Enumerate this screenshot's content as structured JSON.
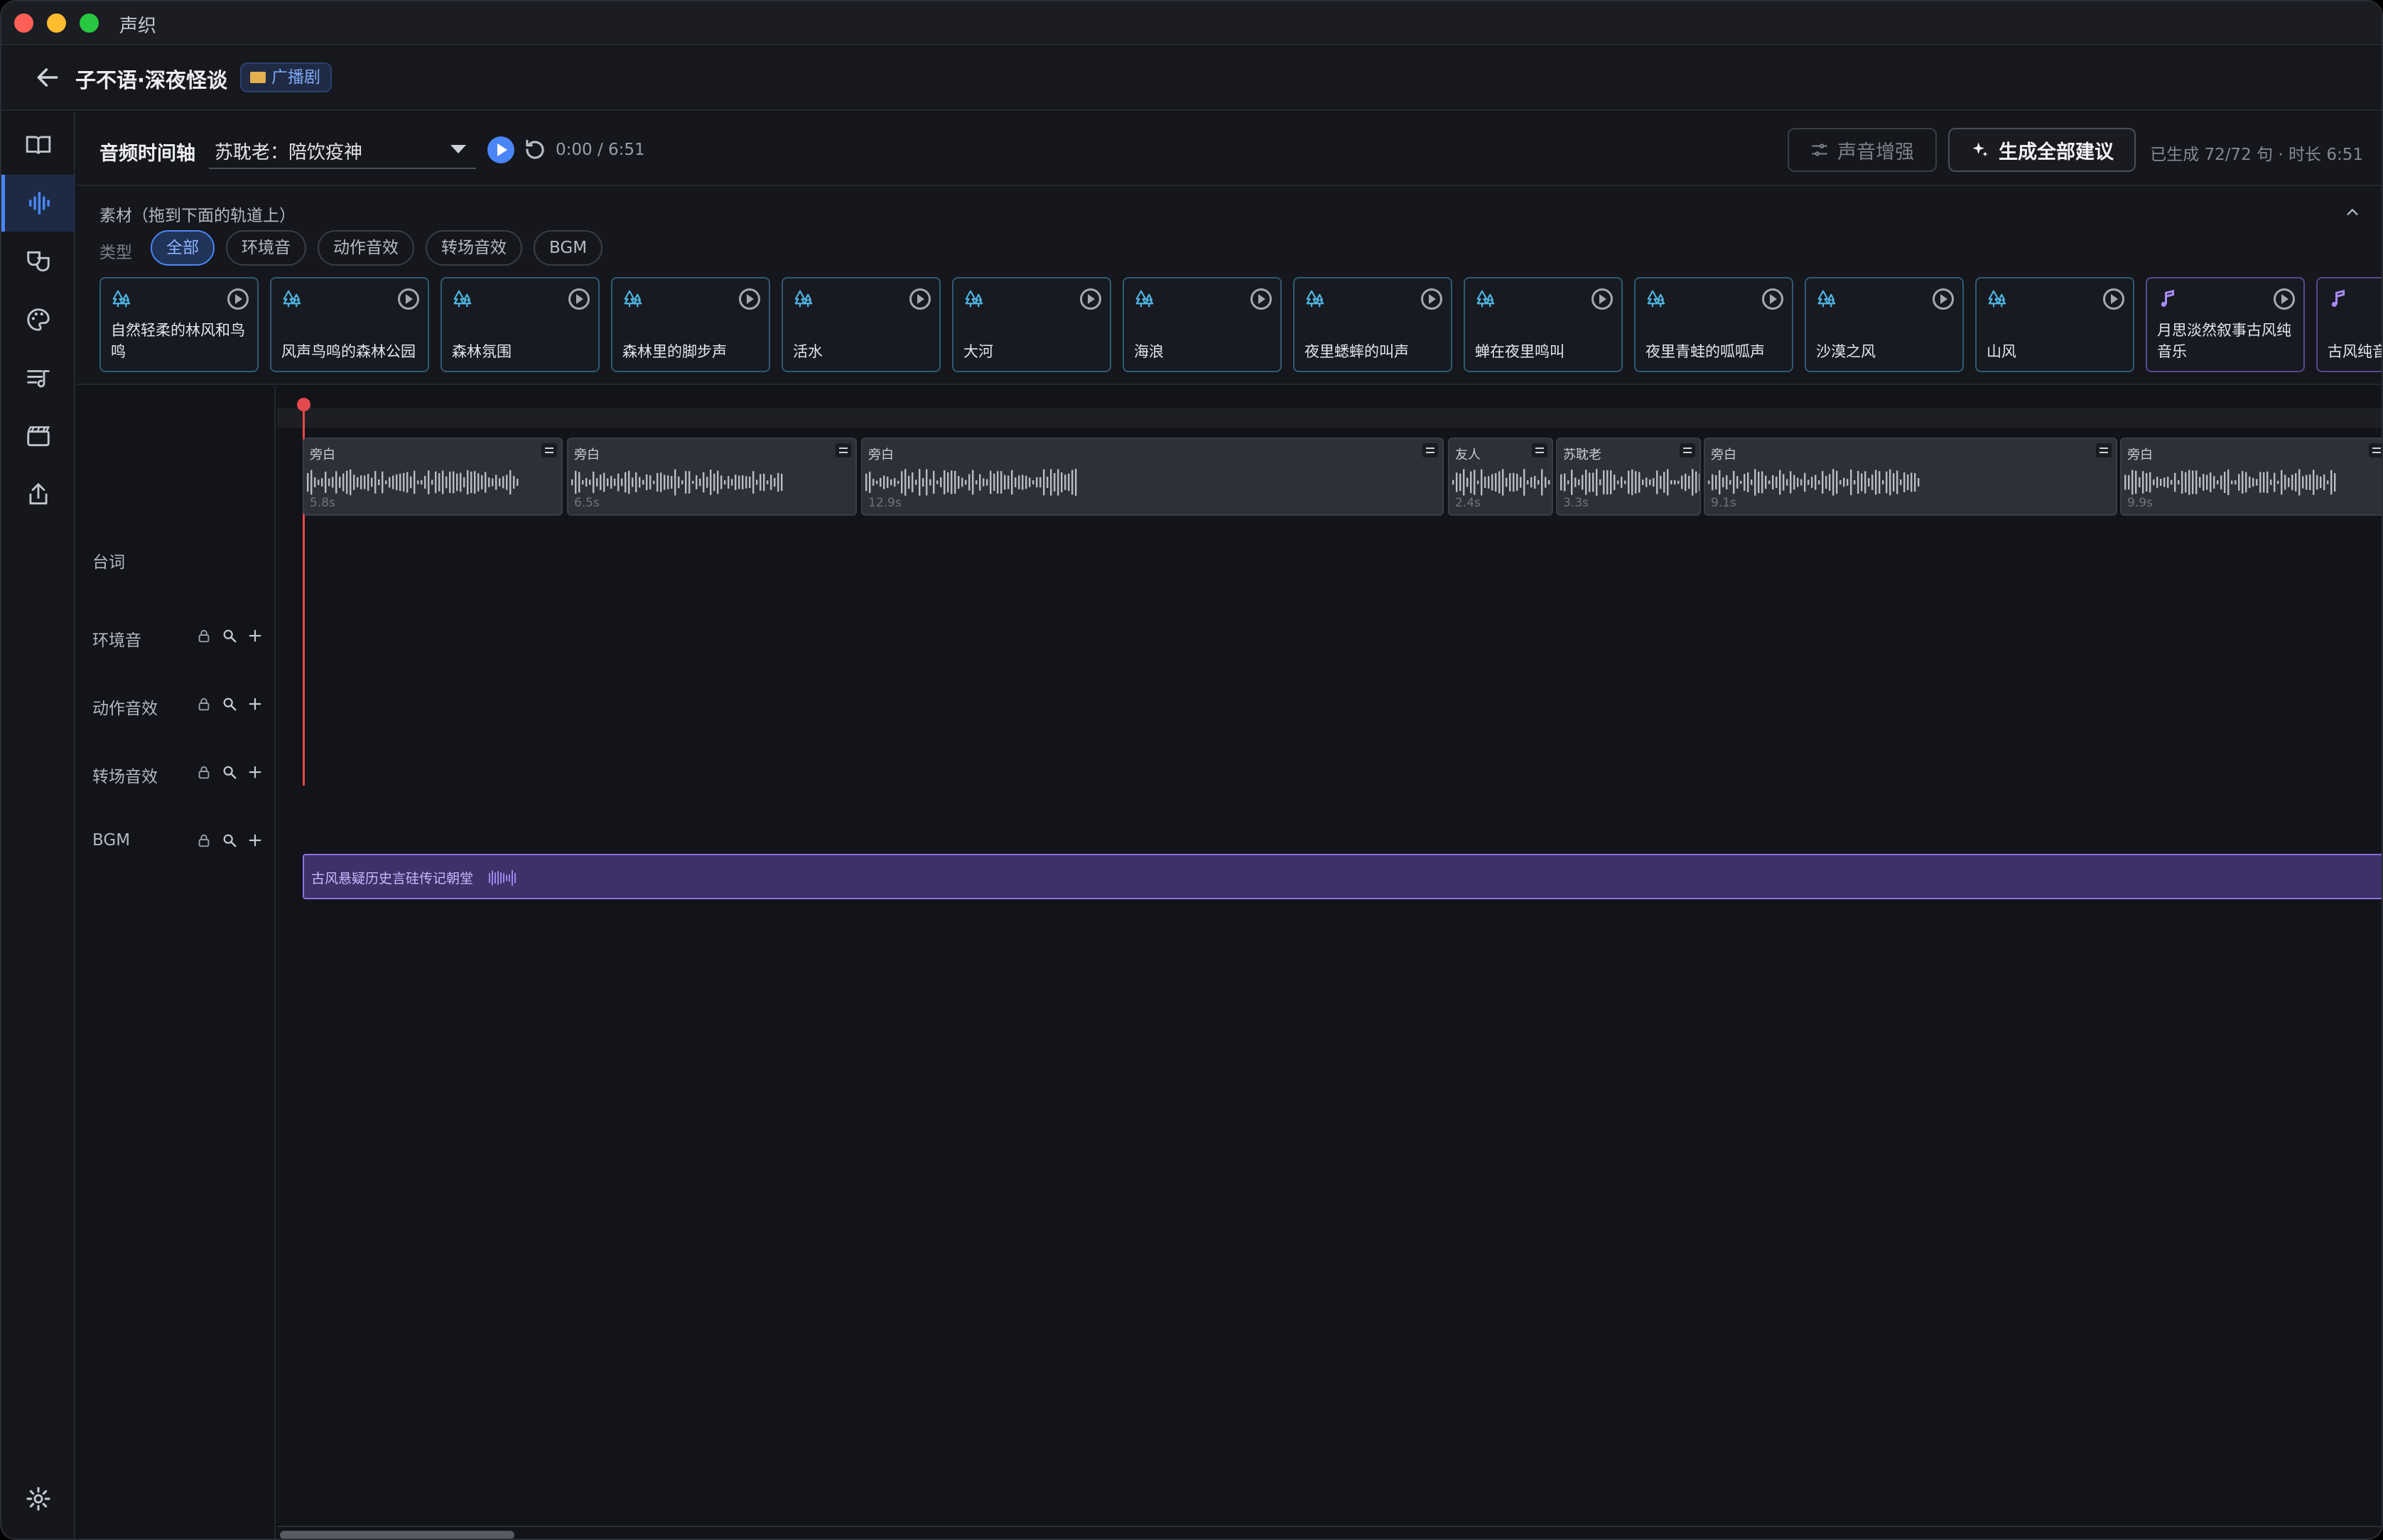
{
  "app": {
    "title": "声织"
  },
  "project": {
    "title": "子不语·深夜怪谈",
    "tag": "广播剧"
  },
  "rail": {
    "items": [
      "script-icon",
      "waveform-icon",
      "masks-icon",
      "palette-icon",
      "playlist-icon",
      "clapperboard-icon",
      "export-icon"
    ],
    "settings": "gear-icon"
  },
  "timeline": {
    "title": "音频时间轴",
    "selected_scene": "苏耽老：陪饮疫神",
    "time": "0:00 / 6:51",
    "enhance_label": "声音增强",
    "generate_label": "生成全部建议",
    "status": "已生成 72/72 句 · 时长 6:51"
  },
  "assets": {
    "title": "素材（拖到下面的轨道上）",
    "type_label": "类型",
    "filters": [
      {
        "label": "全部",
        "active": true
      },
      {
        "label": "环境音",
        "active": false
      },
      {
        "label": "动作音效",
        "active": false
      },
      {
        "label": "转场音效",
        "active": false
      },
      {
        "label": "BGM",
        "active": false
      }
    ],
    "cards": [
      {
        "label": "自然轻柔的林风和鸟鸣",
        "kind": "ambience"
      },
      {
        "label": "风声鸟鸣的森林公园",
        "kind": "ambience"
      },
      {
        "label": "森林氛围",
        "kind": "ambience"
      },
      {
        "label": "森林里的脚步声",
        "kind": "ambience"
      },
      {
        "label": "活水",
        "kind": "ambience"
      },
      {
        "label": "大河",
        "kind": "ambience"
      },
      {
        "label": "海浪",
        "kind": "ambience"
      },
      {
        "label": "夜里蟋蟀的叫声",
        "kind": "ambience"
      },
      {
        "label": "蝉在夜里鸣叫",
        "kind": "ambience"
      },
      {
        "label": "夜里青蛙的呱呱声",
        "kind": "ambience"
      },
      {
        "label": "沙漠之风",
        "kind": "ambience"
      },
      {
        "label": "山风",
        "kind": "ambience"
      },
      {
        "label": "月思淡然叙事古风纯音乐",
        "kind": "music"
      },
      {
        "label": "古风纯音",
        "kind": "music"
      }
    ]
  },
  "tracks": {
    "labels": [
      "台词",
      "环境音",
      "动作音效",
      "转场音效",
      "BGM"
    ],
    "dialogue_clips": [
      {
        "speaker": "旁白",
        "duration": "5.8s"
      },
      {
        "speaker": "旁白",
        "duration": "6.5s"
      },
      {
        "speaker": "旁白",
        "duration": "12.9s"
      },
      {
        "speaker": "友人",
        "duration": "2.4s"
      },
      {
        "speaker": "苏耽老",
        "duration": "3.3s"
      },
      {
        "speaker": "旁白",
        "duration": "9.1s"
      },
      {
        "speaker": "旁白",
        "duration": "9.9s"
      }
    ],
    "bgm_clip": "古风悬疑历史言硅传记朝堂"
  },
  "colors": {
    "accent": "#4a86f7",
    "playhead": "#e5484d",
    "bgm": "#8a6fe8",
    "ambience": "#4fb3e0"
  }
}
